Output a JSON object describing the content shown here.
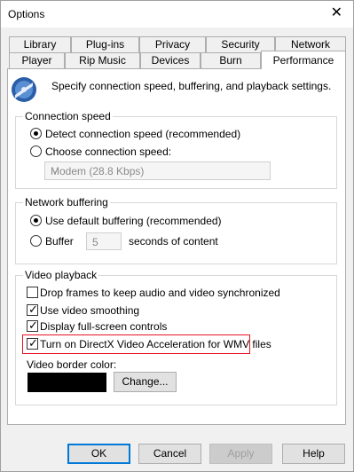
{
  "window": {
    "title": "Options",
    "close_glyph": "✕"
  },
  "tabs_row1": [
    "Library",
    "Plug-ins",
    "Privacy",
    "Security",
    "Network"
  ],
  "tabs_row2": [
    "Player",
    "Rip Music",
    "Devices",
    "Burn",
    "Performance"
  ],
  "active_tab": "Performance",
  "intro": {
    "icon": "media-player-icon",
    "text": "Specify connection speed, buffering, and playback settings."
  },
  "connection_speed": {
    "title": "Connection speed",
    "detect_label": "Detect connection speed (recommended)",
    "detect_selected": true,
    "choose_label": "Choose connection speed:",
    "choose_selected": false,
    "speed_value": "Modem (28.8 Kbps)",
    "chevron_glyph": "⌄"
  },
  "network_buffering": {
    "title": "Network buffering",
    "default_label": "Use default buffering (recommended)",
    "default_selected": true,
    "buffer_label": "Buffer",
    "buffer_selected": false,
    "buffer_value": "5",
    "seconds_label": "seconds of content"
  },
  "video_playback": {
    "title": "Video playback",
    "options": [
      {
        "label": "Drop frames to keep audio and video synchronized",
        "checked": false
      },
      {
        "label": "Use video smoothing",
        "checked": true
      },
      {
        "label": "Display full-screen controls",
        "checked": true
      },
      {
        "label": "Turn on DirectX Video Acceleration for WMV files",
        "checked": true
      }
    ],
    "highlight_color": "#e81123",
    "border_color_label": "Video border color:",
    "border_color_value": "#000000",
    "change_button": "Change..."
  },
  "footer": {
    "ok": "OK",
    "cancel": "Cancel",
    "apply": "Apply",
    "help": "Help"
  },
  "check_glyph": "✓"
}
